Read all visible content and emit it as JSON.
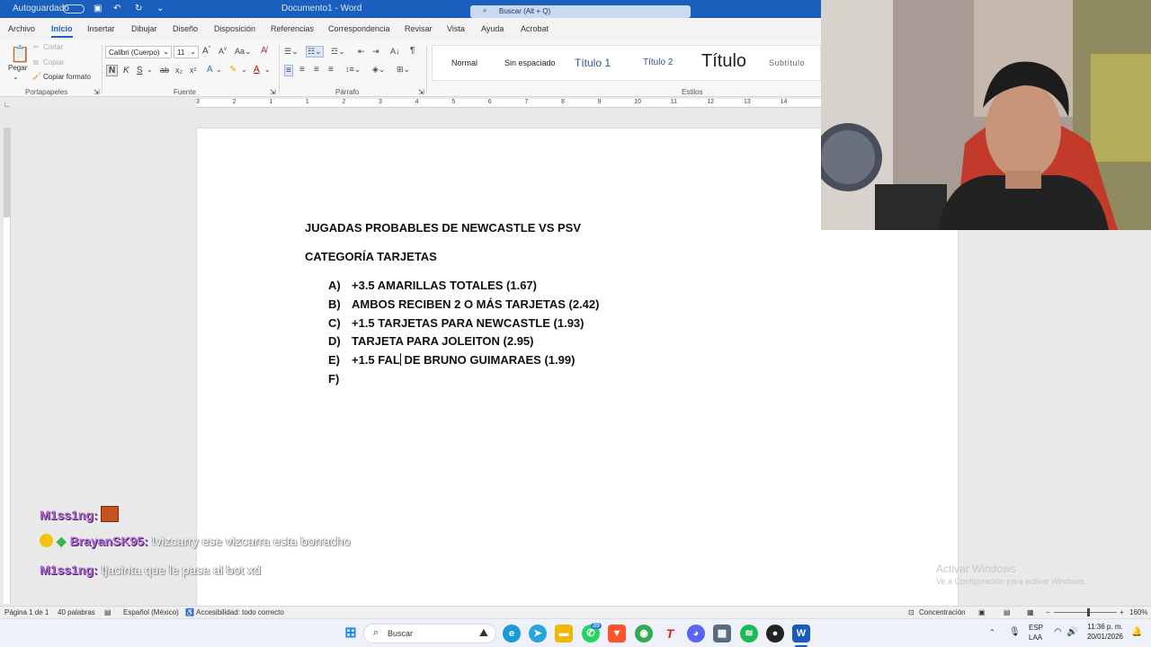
{
  "titlebar": {
    "autosave_label": "Autoguardado",
    "document_title": "Documento1 - Word",
    "search_placeholder": "Buscar (Alt + Q)",
    "color": "#1b5fbd"
  },
  "menu": {
    "tabs": [
      "Archivo",
      "Inicio",
      "Insertar",
      "Dibujar",
      "Diseño",
      "Disposición",
      "Referencias",
      "Correspondencia",
      "Revisar",
      "Vista",
      "Ayuda",
      "Acrobat"
    ],
    "active_tab": "Inicio"
  },
  "ribbon": {
    "clipboard": {
      "paste_label": "Pegar",
      "cut_label": "Cortar",
      "copy_label": "Copiar",
      "format_painter_label": "Copiar formato",
      "group_label": "Portapapeles"
    },
    "font": {
      "font_name": "Calibri (Cuerpo)",
      "font_size": "11",
      "group_label": "Fuente"
    },
    "paragraph": {
      "group_label": "Párrafo"
    },
    "styles": {
      "items": [
        "Normal",
        "Sin espaciado",
        "Título 1",
        "Título 2",
        "Título",
        "Subtítulo"
      ],
      "group_label": "Estilos"
    }
  },
  "ruler": {
    "marks": [
      "3",
      "2",
      "1",
      "1",
      "2",
      "3",
      "4",
      "5",
      "6",
      "7",
      "8",
      "9",
      "10",
      "11",
      "12",
      "13",
      "14"
    ]
  },
  "document": {
    "heading": "JUGADAS PROBABLES DE NEWCASTLE VS PSV",
    "category": "CATEGORÍA TARJETAS",
    "items": [
      {
        "letter": "A)",
        "text": "+3.5 AMARILLAS TOTALES (1.67)"
      },
      {
        "letter": "B)",
        "text": "AMBOS RECIBEN 2 O MÁS TARJETAS (2.42)"
      },
      {
        "letter": "C)",
        "text": "+1.5 TARJETAS PARA NEWCASTLE (1.93)"
      },
      {
        "letter": "D)",
        "text": "TARJETA PARA JOLEITON (2.95)"
      },
      {
        "letter": "E)",
        "text_before_cursor": "+1.5 FAL",
        "text_after_cursor": "DE BRUNO GUIMARAES (1.99)"
      },
      {
        "letter": "F)",
        "text": ""
      }
    ]
  },
  "chat": [
    {
      "user": "M1ss1ng:",
      "message": ""
    },
    {
      "user": "BrayanSK95:",
      "message": "!vizcarry ese vizcarra esta borracho"
    },
    {
      "user": "M1ss1ng:",
      "message": "!jacinta que le pasa al bot xd"
    }
  ],
  "watermark": {
    "title": "Activar Windows",
    "subtitle": "Ve a Configuración para activar Windows."
  },
  "statusbar": {
    "page": "Página 1 de 1",
    "words": "40 palabras",
    "language": "Español (México)",
    "accessibility": "Accesibilidad: todo correcto",
    "focus": "Concentración",
    "zoom": "160%"
  },
  "taskbar": {
    "search_label": "Buscar",
    "whatsapp_badge": "39",
    "lang_top": "ESP",
    "lang_bottom": "LAA",
    "time": "11:36 p. m.",
    "date": "20/01/2026"
  }
}
